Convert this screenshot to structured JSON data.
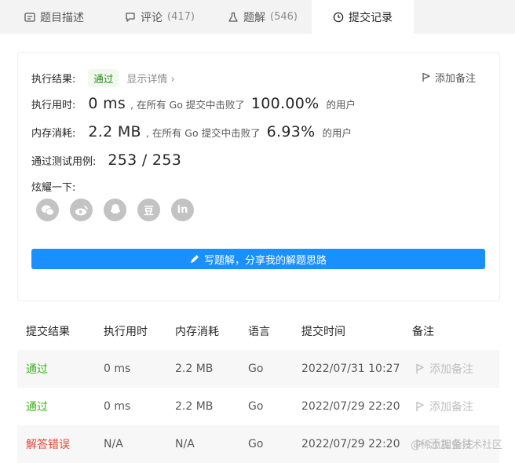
{
  "tabs": [
    {
      "label": "题目描述",
      "count": ""
    },
    {
      "label": "评论",
      "count": "(417)"
    },
    {
      "label": "题解",
      "count": "(546)"
    },
    {
      "label": "提交记录",
      "count": ""
    }
  ],
  "result": {
    "status_label": "执行结果:",
    "status_value": "通过",
    "detail_link": "显示详情 ›",
    "add_note": "添加备注",
    "time_label": "执行用时:",
    "time_value": "0 ms",
    "time_mid": ", 在所有 Go 提交中击败了",
    "time_pct": "100.00%",
    "time_suffix": "的用户",
    "mem_label": "内存消耗:",
    "mem_value": "2.2 MB",
    "mem_mid": ", 在所有 Go 提交中击败了",
    "mem_pct": "6.93%",
    "mem_suffix": "的用户",
    "tests_label": "通过测试用例:",
    "tests_value": "253 / 253",
    "share_label": "炫耀一下:",
    "share_icons": [
      "wechat-icon",
      "weibo-icon",
      "qq-icon",
      "douban-icon",
      "linkedin-icon"
    ],
    "douban_glyph": "豆",
    "linkedin_glyph": "in",
    "write_button": "写题解，分享我的解题思路"
  },
  "table": {
    "headers": [
      "提交结果",
      "执行用时",
      "内存消耗",
      "语言",
      "提交时间",
      "备注"
    ],
    "rows": [
      {
        "status": "通过",
        "time": "0 ms",
        "memory": "2.2 MB",
        "lang": "Go",
        "submitted": "2022/07/31 10:27",
        "note": "添加备注",
        "kind": "ok"
      },
      {
        "status": "通过",
        "time": "0 ms",
        "memory": "2.2 MB",
        "lang": "Go",
        "submitted": "2022/07/29 22:20",
        "note": "添加备注",
        "kind": "ok"
      },
      {
        "status": "解答错误",
        "time": "N/A",
        "memory": "N/A",
        "lang": "Go",
        "submitted": "2022/07/29 22:20",
        "note": "添加备注",
        "kind": "err"
      }
    ]
  },
  "watermark": "@稀土掘金技术社区",
  "colors": {
    "accent": "#1a90ff",
    "ok": "#3bb31c",
    "error": "#e8443a"
  }
}
